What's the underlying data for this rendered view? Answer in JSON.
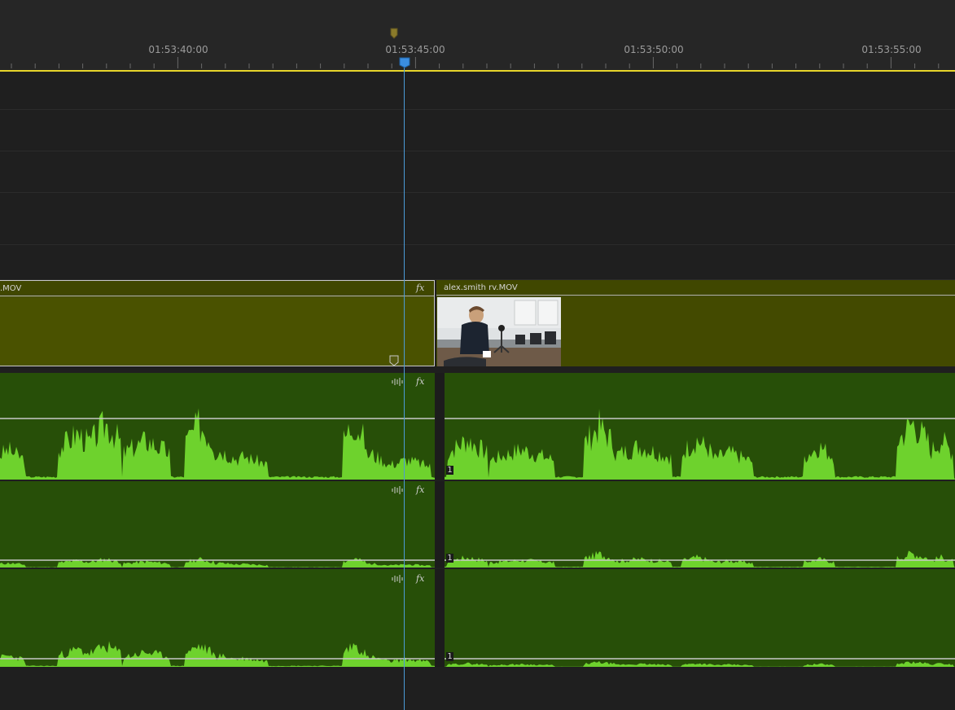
{
  "ruler": {
    "timecodes": [
      "01:53:40:00",
      "01:53:45:00",
      "01:53:50:00",
      "01:53:55:00"
    ]
  },
  "video": {
    "clip_left": {
      "name": ".MOV",
      "fx": "fx"
    },
    "clip_right": {
      "name": "alex.smith rv.MOV"
    }
  },
  "audio": {
    "tracks": [
      {
        "fx": "fx",
        "channel": "1"
      },
      {
        "fx": "fx",
        "channel": "1"
      },
      {
        "fx": "fx",
        "channel": "1"
      }
    ]
  },
  "colors": {
    "playhead": "#4b9bd8",
    "work_area": "#e8d52b",
    "video_clip": "#4a5200",
    "audio_clip": "#274f08",
    "waveform": "#6ed22d"
  }
}
